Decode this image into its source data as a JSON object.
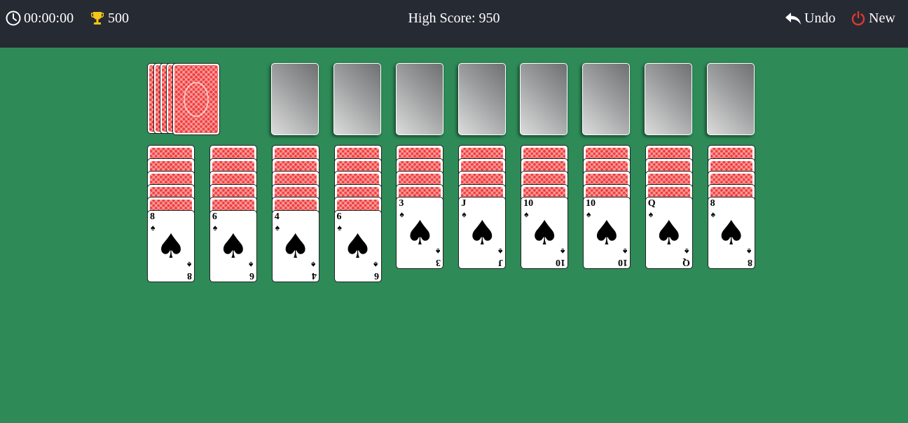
{
  "header": {
    "timer": "00:00:00",
    "score": "500",
    "high_score": "High Score: 950",
    "undo_label": "Undo",
    "new_label": "New"
  },
  "colors": {
    "felt": "#2e8a57",
    "header_bg": "#262a33",
    "card_back": "#f03a3a",
    "trophy": "#f5c518",
    "power_icon": "#e0382f"
  },
  "stock": {
    "stacks": 5
  },
  "foundations": {
    "count": 8
  },
  "tableau": [
    {
      "face_down": 5,
      "face_up": [
        {
          "rank": "8",
          "suit": "♠"
        }
      ]
    },
    {
      "face_down": 5,
      "face_up": [
        {
          "rank": "6",
          "suit": "♠"
        }
      ]
    },
    {
      "face_down": 5,
      "face_up": [
        {
          "rank": "4",
          "suit": "♠"
        }
      ]
    },
    {
      "face_down": 5,
      "face_up": [
        {
          "rank": "6",
          "suit": "♠"
        }
      ]
    },
    {
      "face_down": 4,
      "face_up": [
        {
          "rank": "3",
          "suit": "♠"
        }
      ]
    },
    {
      "face_down": 4,
      "face_up": [
        {
          "rank": "J",
          "suit": "♠"
        }
      ]
    },
    {
      "face_down": 4,
      "face_up": [
        {
          "rank": "10",
          "suit": "♠"
        }
      ]
    },
    {
      "face_down": 4,
      "face_up": [
        {
          "rank": "10",
          "suit": "♠"
        }
      ]
    },
    {
      "face_down": 4,
      "face_up": [
        {
          "rank": "Q",
          "suit": "♠"
        }
      ]
    },
    {
      "face_down": 4,
      "face_up": [
        {
          "rank": "8",
          "suit": "♠"
        }
      ]
    }
  ]
}
